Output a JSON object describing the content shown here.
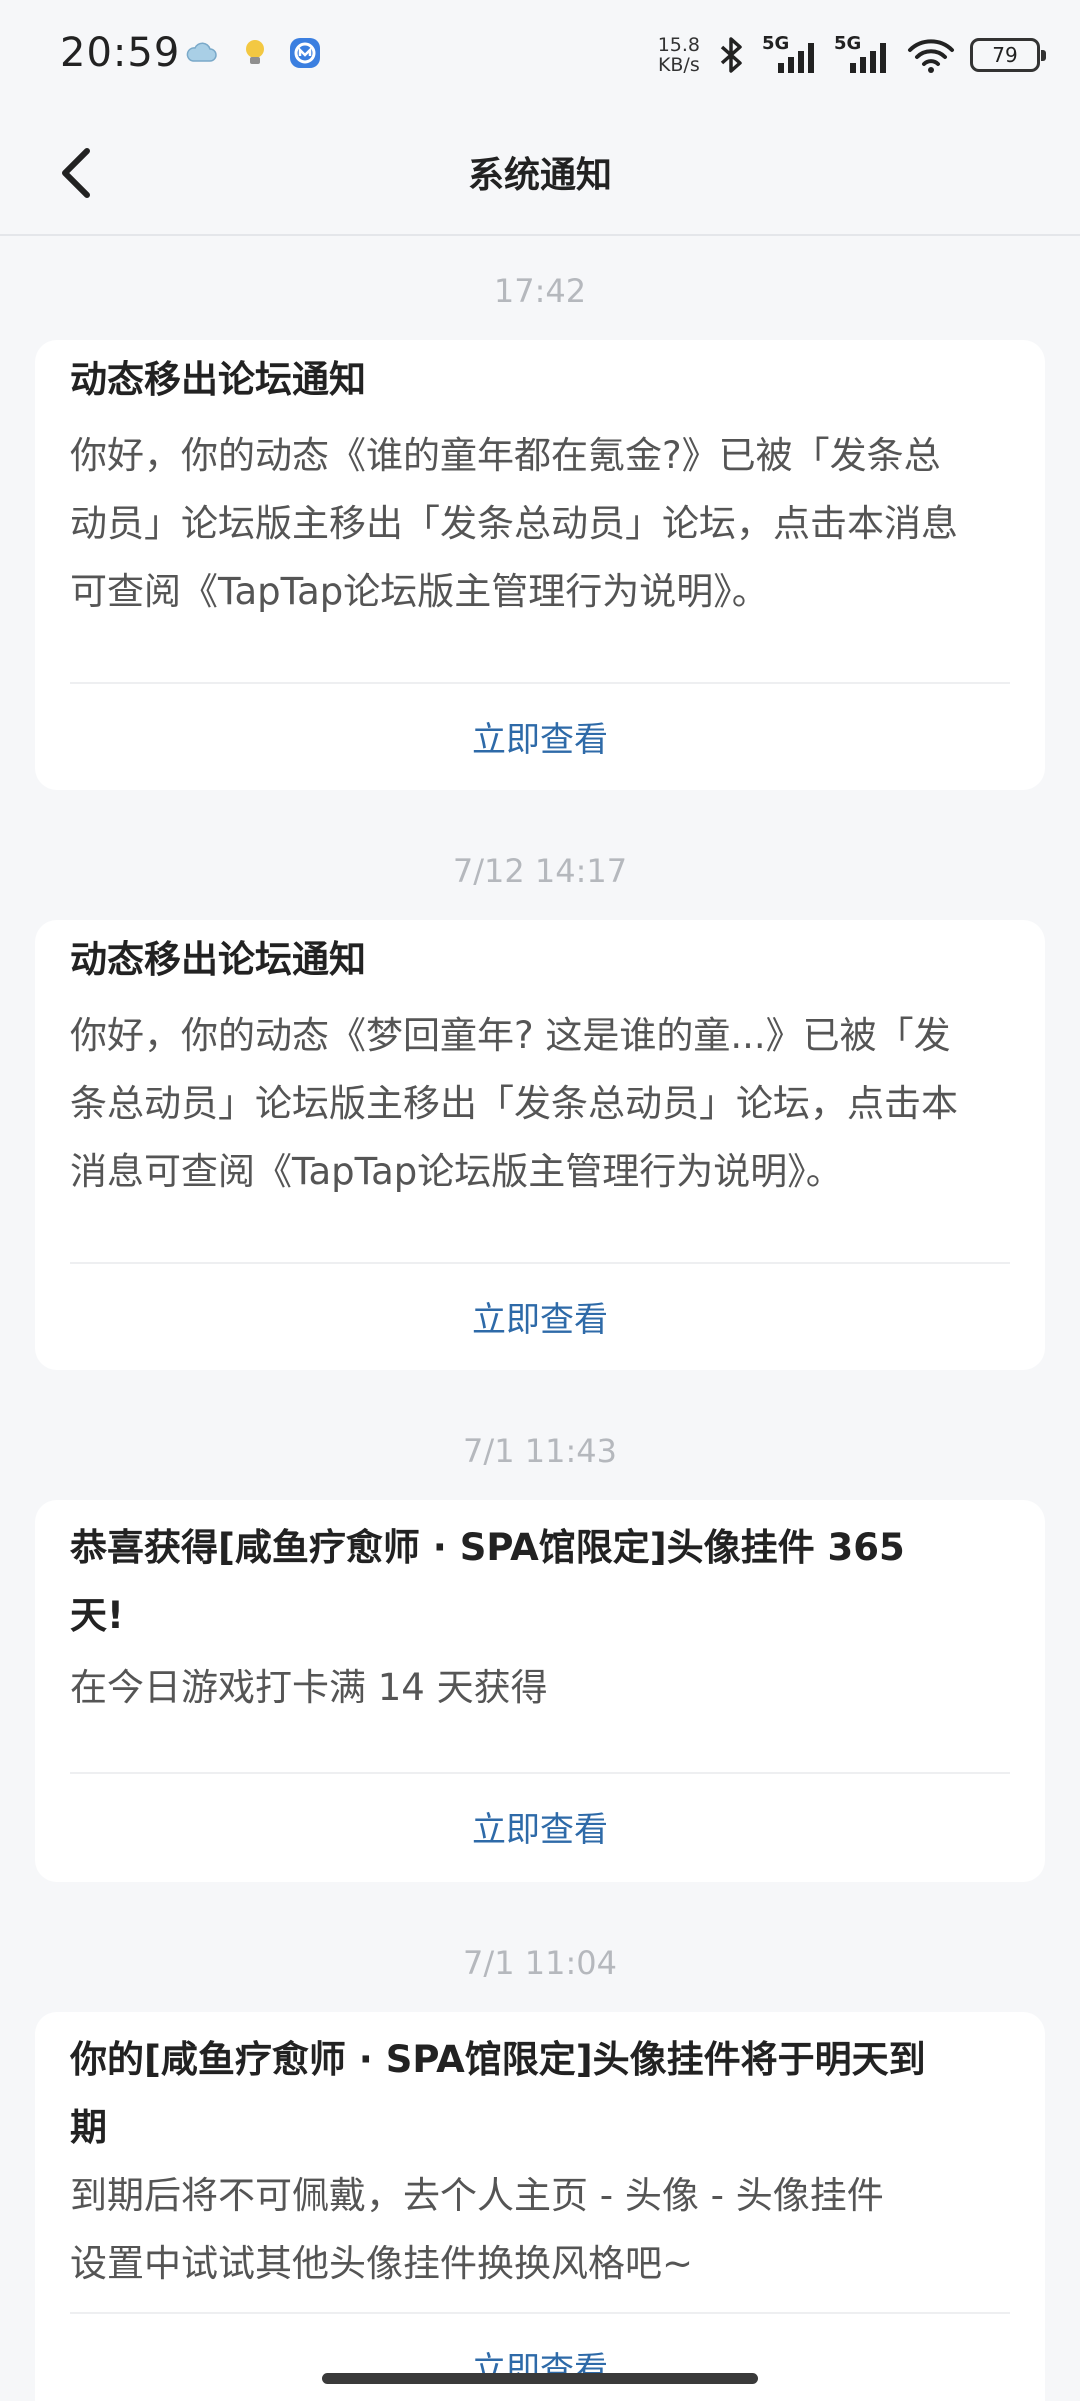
{
  "status_bar": {
    "time": "20:59",
    "net_speed_value": "15.8",
    "net_speed_unit": "KB/s",
    "network_1": "5G",
    "network_2": "5G",
    "battery": "79",
    "icons": [
      "cloud-icon",
      "lightbulb-icon",
      "app-notification-icon",
      "bluetooth-icon",
      "signal-icon",
      "signal-icon",
      "wifi-icon",
      "battery-icon"
    ]
  },
  "header": {
    "title": "系统通知",
    "back_icon": "chevron-left-icon"
  },
  "notifications": [
    {
      "timestamp": "17:42",
      "title": "动态移出论坛通知",
      "body_lines": [
        "你好，你的动态《谁的童年都在氪金?》已被「发条总",
        "动员」论坛版主移出「发条总动员」论坛，点击本消息",
        "可查阅《TapTap论坛版主管理行为说明》。"
      ],
      "action": "立即查看"
    },
    {
      "timestamp": "7/12  14:17",
      "title": "动态移出论坛通知",
      "body_lines": [
        "你好，你的动态《梦回童年? 这是谁的童...》已被「发",
        "条总动员」论坛版主移出「发条总动员」论坛，点击本",
        "消息可查阅《TapTap论坛版主管理行为说明》。"
      ],
      "action": "立即查看"
    },
    {
      "timestamp": "7/1  11:43",
      "title_lines": [
        "恭喜获得[咸鱼疗愈师 · SPA馆限定]头像挂件 365",
        "天!"
      ],
      "body_lines": [
        "在今日游戏打卡满 14 天获得"
      ],
      "action": "立即查看"
    },
    {
      "timestamp": "7/1  11:04",
      "title_lines": [
        "你的[咸鱼疗愈师 · SPA馆限定]头像挂件将于明天到",
        "期"
      ],
      "body_lines": [
        "到期后将不可佩戴，去个人主页 - 头像 - 头像挂件",
        "设置中试试其他头像挂件换换风格吧~"
      ],
      "action": "立即查看"
    }
  ],
  "colors": {
    "background": "#f6f7f9",
    "card": "#ffffff",
    "action_link": "#2e6aa8",
    "timestamp": "#b5b8bd"
  }
}
